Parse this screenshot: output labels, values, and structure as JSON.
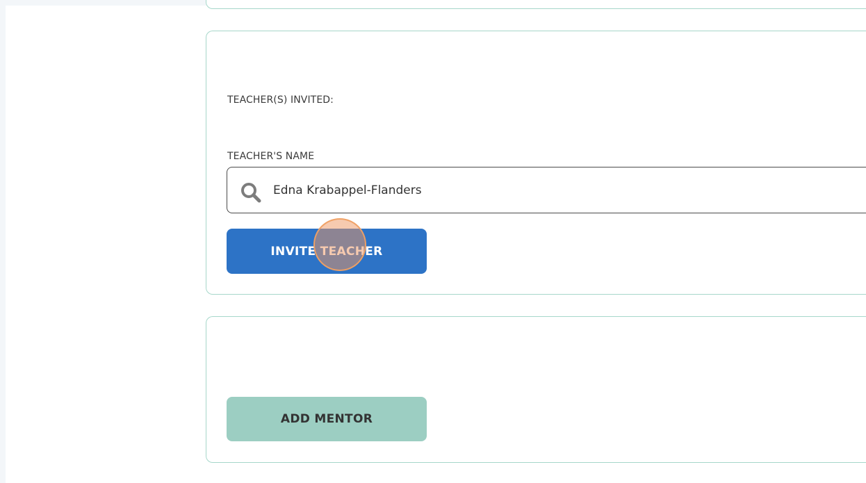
{
  "teachers_section": {
    "invited_label": "TEACHER(S) INVITED:",
    "name_label": "TEACHER'S NAME",
    "search_value": "Edna Krabappel-Flanders",
    "invite_button_label": "INVITE TEACHER"
  },
  "mentor_section": {
    "add_button_label": "ADD MENTOR"
  },
  "colors": {
    "primary": "#2d73c6",
    "secondary": "#9ccec2",
    "card_border": "#a6d7ca",
    "click_marker": "#ee965f"
  },
  "icons": {
    "search": "search-icon"
  }
}
